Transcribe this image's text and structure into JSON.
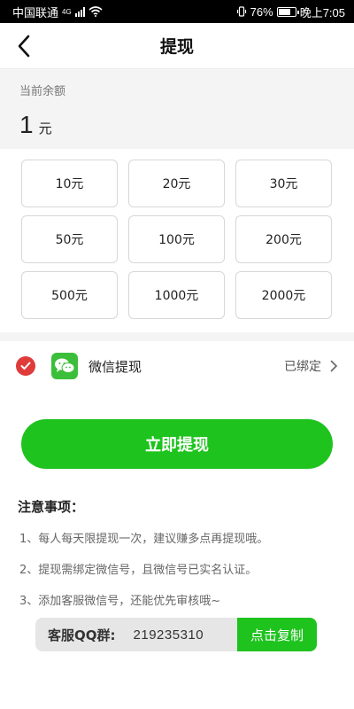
{
  "status_bar": {
    "carrier": "中国联通",
    "network": "4G",
    "battery": "76%",
    "battery_level": 0.76,
    "time": "晚上7:05"
  },
  "nav": {
    "title": "提现",
    "back_icon": "chevron-left-icon"
  },
  "balance": {
    "label": "当前余额",
    "value": "1",
    "unit": "元"
  },
  "amounts": [
    "10元",
    "20元",
    "30元",
    "50元",
    "100元",
    "200元",
    "500元",
    "1000元",
    "2000元"
  ],
  "payment": {
    "selected": true,
    "check_color": "#e03b3b",
    "logo_icon": "wechat-icon",
    "name": "微信提现",
    "status": "已绑定"
  },
  "submit_label": "立即提现",
  "notes": {
    "title": "注意事项：",
    "items": [
      "1、每人每天限提现一次，建议赚多点再提现哦。",
      "2、提现需绑定微信号，且微信号已实名认证。",
      "3、添加客服微信号，还能优先审核哦~"
    ]
  },
  "qq_group": {
    "label": "客服QQ群:",
    "number": "219235310",
    "copy_label": "点击复制"
  },
  "colors": {
    "accent_green": "#1ec31e",
    "wechat_green": "#3bbf3b",
    "background_gray": "#f4f4f4"
  }
}
